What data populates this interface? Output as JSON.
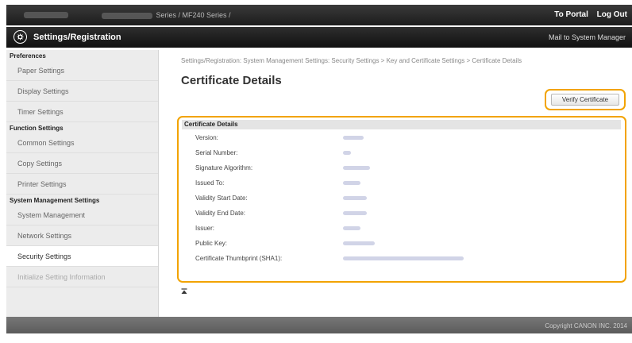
{
  "header": {
    "model_text": "Series / MF240 Series /",
    "links": [
      "To Portal",
      "Log Out"
    ]
  },
  "titlebar": {
    "title": "Settings/Registration",
    "mail_link": "Mail to System Manager",
    "icon": "settings-gear-icon"
  },
  "sidebar": {
    "sections": [
      {
        "heading": "Preferences",
        "items": [
          "Paper Settings",
          "Display Settings",
          "Timer Settings"
        ]
      },
      {
        "heading": "Function Settings",
        "items": [
          "Common Settings",
          "Copy Settings",
          "Printer Settings"
        ]
      },
      {
        "heading": "System Management Settings",
        "items": [
          "System Management",
          "Network Settings",
          "Security Settings",
          "Initialize Setting Information"
        ]
      }
    ],
    "active_item": "Security Settings"
  },
  "main": {
    "breadcrumb": "Settings/Registration: System Management Settings: Security Settings > Key and Certificate Settings > Certificate Details",
    "title": "Certificate Details",
    "verify_button": "Verify Certificate",
    "details_heading": "Certificate Details",
    "fields": [
      "Version:",
      "Serial Number:",
      "Signature Algorithm:",
      "Issued To:",
      "Validity Start Date:",
      "Validity End Date:",
      "Issuer:",
      "Public Key:",
      "Certificate Thumbprint (SHA1):"
    ]
  },
  "footer": {
    "copyright": "Copyright CANON INC. 2014"
  },
  "colors": {
    "highlight": "#f2a300",
    "header_bg": "#1c1c1c",
    "sidebar_bg": "#ececec"
  }
}
